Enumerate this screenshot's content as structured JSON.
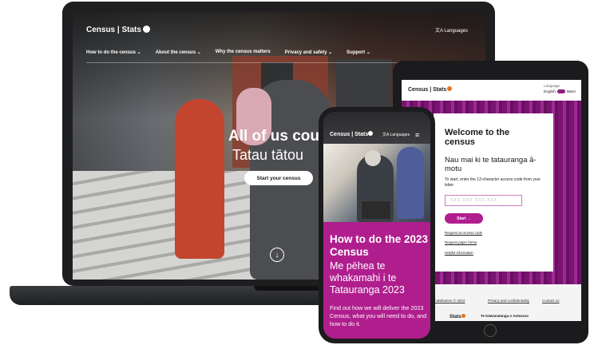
{
  "laptop": {
    "logo": "Census | Stats",
    "languages_label": "Languages",
    "nav_items": [
      {
        "label": "How to do the census ⌄"
      },
      {
        "label": "About the census ⌄"
      },
      {
        "label": "Why the census matters"
      },
      {
        "label": "Privacy and safety ⌄"
      },
      {
        "label": "Support ⌄"
      }
    ],
    "hero_title": "All of us cour",
    "hero_subtitle": "Tatau tātou",
    "cta_label": "Start your census",
    "scroll_glyph": "↓"
  },
  "tablet": {
    "logo": "Census | Stats",
    "language_label": "Language",
    "toggle_left": "English",
    "toggle_right": "Māori",
    "welcome_title": "Welcome to the census",
    "welcome_maori": "Nau mai ki te tatauranga ā-motu",
    "instruction": "To start, enter the 12-character access code from your letter",
    "code_placeholder": "XXX XXX XXX XXX",
    "start_label": "Start →",
    "links": [
      {
        "label": "Request an access code"
      },
      {
        "label": "Request paper forms"
      },
      {
        "label": "Helpful information"
      }
    ],
    "footer_links": [
      {
        "label": "ht and attribution © 2023"
      },
      {
        "label": "Privacy and confidentiality"
      },
      {
        "label": "Contact us"
      }
    ],
    "footer_stats": "Stats",
    "footer_kawa": "Te Kāwanatanga o Aotearoa"
  },
  "phone": {
    "logo": "Census | Stats",
    "languages_label": "Languages",
    "menu_glyph": "≡",
    "title": "How to do the 2023 Census",
    "subtitle": "Me pēhea te whakamahi i te Tatauranga 2023",
    "body": "Find out how we will deliver the 2023 Census, what you will need to do, and how to do it."
  },
  "colors": {
    "brand_purple": "#b01e8e",
    "stats_orange": "#e8731a",
    "dark_frame": "#1e1e20"
  }
}
